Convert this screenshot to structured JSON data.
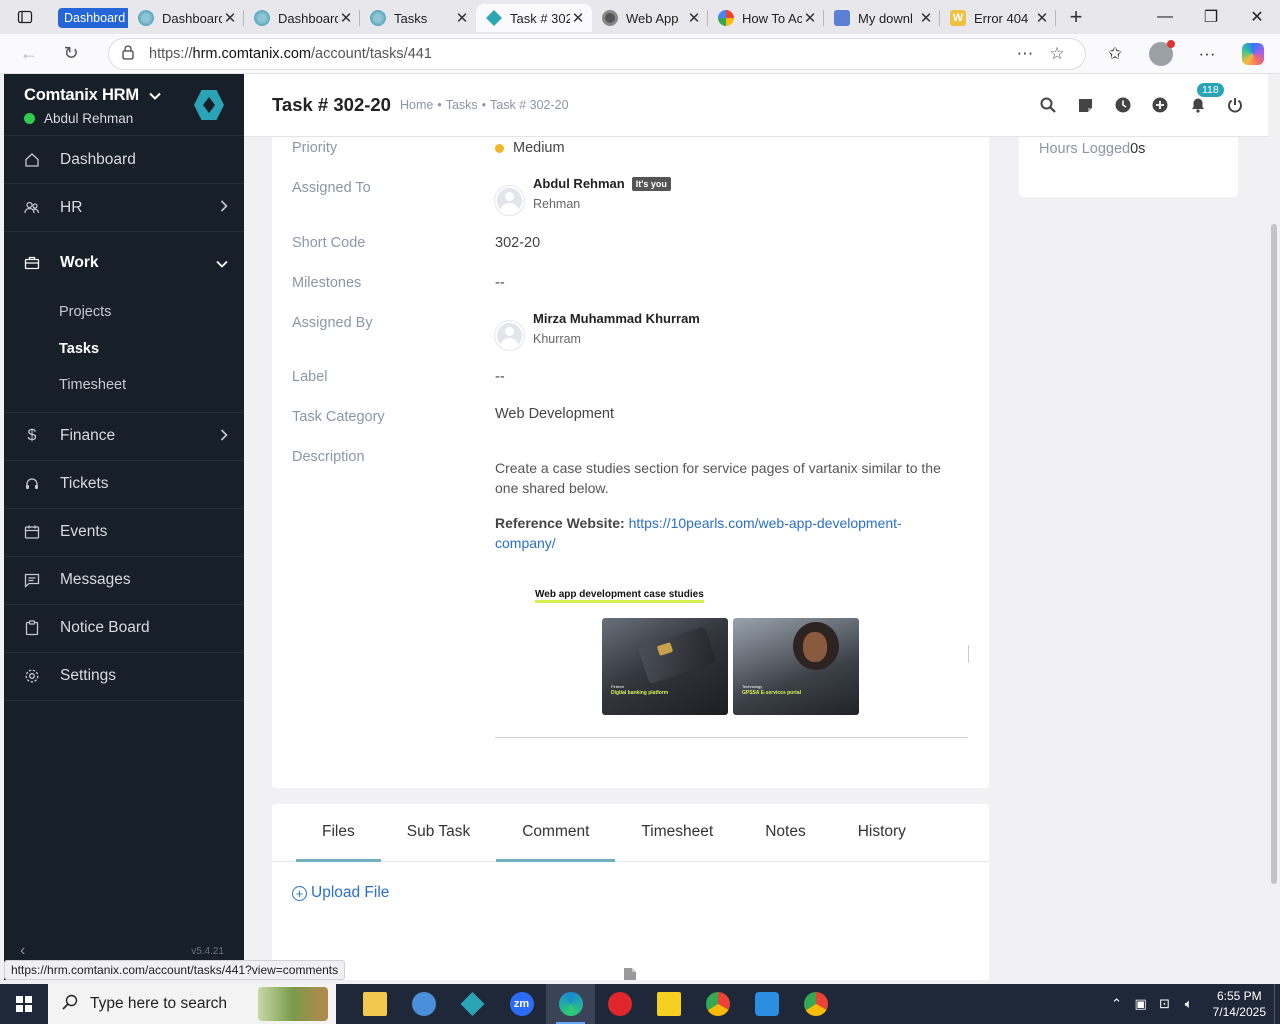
{
  "browser": {
    "tabs": [
      {
        "group_label": "Dashboard",
        "favicon": "group",
        "active": false
      },
      {
        "title": "Dashboard",
        "favicon": "hrm-icon",
        "active": false
      },
      {
        "title": "Dashboard",
        "favicon": "hrm-icon",
        "active": false
      },
      {
        "title": "Tasks",
        "favicon": "hrm-icon",
        "active": false
      },
      {
        "title": "Task # 302",
        "favicon": "hrm-active-icon",
        "active": true
      },
      {
        "title": "Web App",
        "favicon": "webapp-icon",
        "active": false
      },
      {
        "title": "How To Ac",
        "favicon": "google-icon",
        "active": false
      },
      {
        "title": "My downl",
        "favicon": "doc-icon",
        "active": false
      },
      {
        "title": "Error 404",
        "favicon": "w-icon",
        "active": false
      }
    ],
    "url_prefix": "https://",
    "url_host": "hrm.comtanix.com",
    "url_path": "/account/tasks/441",
    "status_url": "https://hrm.comtanix.com/account/tasks/441?view=comments"
  },
  "sidebar": {
    "company": "Comtanix HRM",
    "user": "Abdul Rehman",
    "items": [
      {
        "label": "Dashboard",
        "icon": "home-icon"
      },
      {
        "label": "HR",
        "icon": "people-icon",
        "has_arrow": true
      },
      {
        "label": "Work",
        "icon": "briefcase-icon",
        "expanded": true
      },
      {
        "label": "Finance",
        "icon": "dollar-icon",
        "has_arrow": true
      },
      {
        "label": "Tickets",
        "icon": "headset-icon"
      },
      {
        "label": "Events",
        "icon": "calendar-icon"
      },
      {
        "label": "Messages",
        "icon": "message-icon"
      },
      {
        "label": "Notice Board",
        "icon": "clipboard-icon"
      },
      {
        "label": "Settings",
        "icon": "gear-icon"
      }
    ],
    "work_subitems": [
      {
        "label": "Projects",
        "active": false
      },
      {
        "label": "Tasks",
        "active": true
      },
      {
        "label": "Timesheet",
        "active": false
      }
    ],
    "version": "v5.4.21"
  },
  "header": {
    "title": "Task # 302-20",
    "breadcrumb": [
      "Home",
      "Tasks",
      "Task # 302-20"
    ],
    "notification_count": "118"
  },
  "task": {
    "priority_label": "Priority",
    "priority_value": "Medium",
    "priority_color": "#f0b528",
    "assigned_to_label": "Assigned To",
    "assigned_to_name": "Abdul Rehman",
    "assigned_to_badge": "It's you",
    "assigned_to_sub": "Rehman",
    "short_code_label": "Short Code",
    "short_code_value": "302-20",
    "milestones_label": "Milestones",
    "milestones_value": "--",
    "assigned_by_label": "Assigned By",
    "assigned_by_name": "Mirza Muhammad Khurram",
    "assigned_by_sub": "Khurram",
    "label_label": "Label",
    "label_value": "--",
    "category_label": "Task Category",
    "category_value": "Web Development",
    "description_label": "Description",
    "description_text": "Create a case studies section for service pages of vartanix similar to the one shared below.",
    "reference_label": "Reference Website:",
    "reference_link": "https://10pearls.com/web-app-development-company/",
    "ref_image": {
      "title": "Web app development case studies",
      "cards": [
        {
          "tag": "Fintech",
          "caption": "Digital banking platform"
        },
        {
          "tag": "Technology",
          "caption": "GPSSA E-services portal"
        }
      ]
    }
  },
  "hours": {
    "label": "Hours Logged",
    "value": "0s"
  },
  "detail_tabs": [
    "Files",
    "Sub Task",
    "Comment",
    "Timesheet",
    "Notes",
    "History"
  ],
  "files": {
    "upload_label": "Upload File"
  },
  "taskbar": {
    "search_placeholder": "Type here to search",
    "time": "6:55 PM",
    "date": "7/14/2025",
    "apps": [
      {
        "name": "file-explorer-icon",
        "color": "#f2c94c"
      },
      {
        "name": "paint-icon",
        "color": "#4a90d9"
      },
      {
        "name": "hrm-app-icon",
        "color": "#29a3b5"
      },
      {
        "name": "zoom-icon",
        "color": "#2d6cf6"
      },
      {
        "name": "edge-icon",
        "color": "#1a8ad4"
      },
      {
        "name": "opera-icon",
        "color": "#e0272c"
      },
      {
        "name": "sticky-notes-icon",
        "color": "#f5d020"
      },
      {
        "name": "chrome-icon",
        "color": "#4285f4"
      },
      {
        "name": "vscode-icon",
        "color": "#2a8fe0"
      },
      {
        "name": "chrome-icon",
        "color": "#4285f4"
      }
    ]
  }
}
